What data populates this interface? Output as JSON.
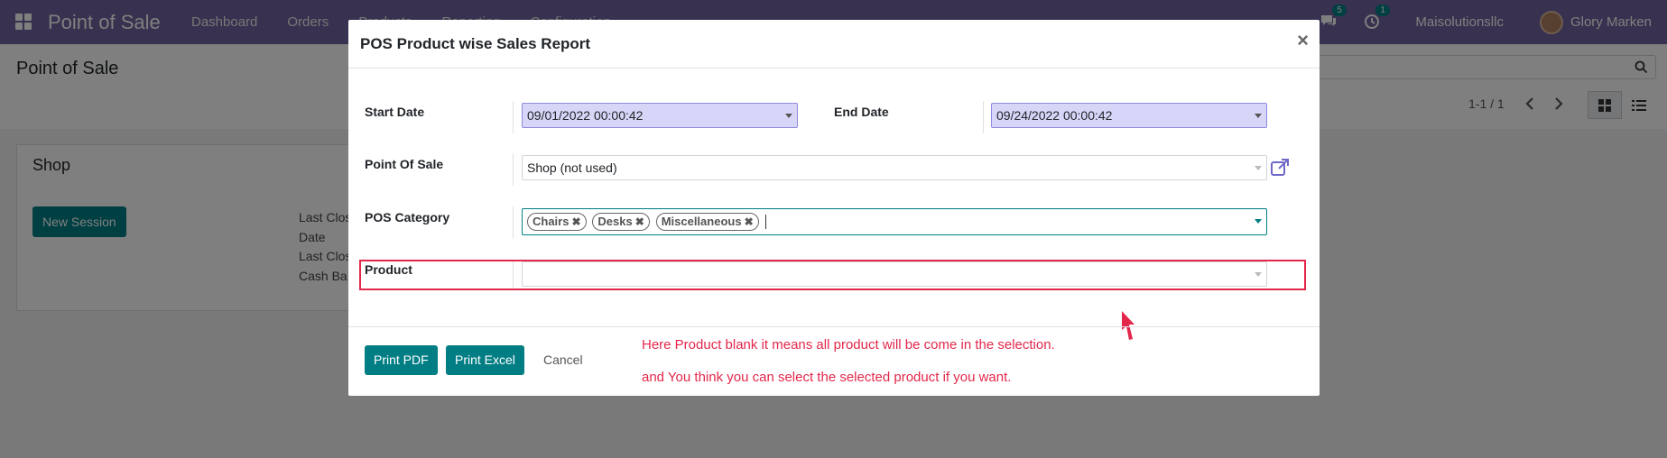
{
  "navbar": {
    "brand": "Point of Sale",
    "menu": [
      "Dashboard",
      "Orders",
      "Products",
      "Reporting",
      "Configuration"
    ],
    "chat_count": "5",
    "activity_count": "1",
    "company": "Maisolutionsllc",
    "user": "Glory Marken"
  },
  "control_panel": {
    "title": "Point of Sale",
    "pager": "1-1 / 1"
  },
  "shop_card": {
    "name": "Shop",
    "new_session_label": "New Session",
    "info_lines": [
      "Last Clos",
      "Date",
      "Last Clos",
      "Cash Ba"
    ]
  },
  "modal": {
    "title": "POS Product wise Sales Report",
    "close": "×",
    "start_date_label": "Start Date",
    "start_date_value": "09/01/2022 00:00:42",
    "end_date_label": "End Date",
    "end_date_value": "09/24/2022 00:00:42",
    "pos_label": "Point Of Sale",
    "pos_value": "Shop (not used)",
    "category_label": "POS Category",
    "category_tags": [
      "Chairs",
      "Desks",
      "Miscellaneous"
    ],
    "product_label": "Product",
    "product_value": "",
    "print_pdf_label": "Print PDF",
    "print_excel_label": "Print Excel",
    "cancel_label": "Cancel",
    "note_line1": "Here Product blank it means all product will be come in the selection.",
    "note_line2": "and You think you can select the selected product if you want."
  },
  "colors": {
    "navbar": "#71639e",
    "primary": "#017e84",
    "annotation": "#e3274b",
    "date_field": "#d8d6f8"
  }
}
